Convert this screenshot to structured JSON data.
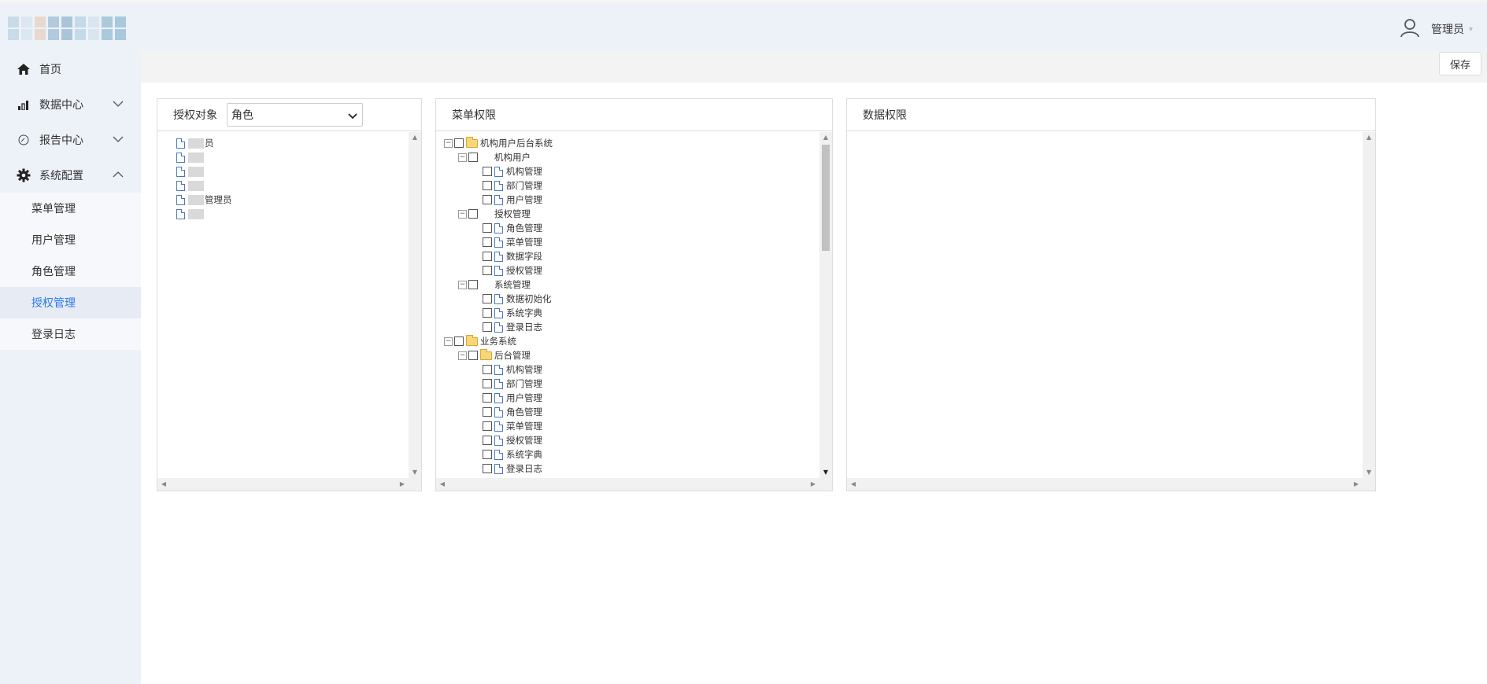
{
  "header": {
    "user_name": "管理员",
    "logo_tiles": [
      "#a8c8dc",
      "#e8d4c8",
      "#8cb4cc",
      "#c8dce8",
      "#9cc0d8",
      "#d4e4ee",
      "#7fa9c9",
      "#bcd6e6",
      "#90b8d0"
    ]
  },
  "sidebar": {
    "items": [
      {
        "label": "首页",
        "icon": "home-icon"
      },
      {
        "label": "数据中心",
        "icon": "bar-chart-icon"
      },
      {
        "label": "报告中心",
        "icon": "gauge-icon"
      },
      {
        "label": "系统配置",
        "icon": "gear-icon"
      }
    ],
    "sub_items": [
      {
        "label": "菜单管理"
      },
      {
        "label": "用户管理"
      },
      {
        "label": "角色管理"
      },
      {
        "label": "授权管理",
        "active": true
      },
      {
        "label": "登录日志"
      }
    ]
  },
  "toolbar": {
    "save_label": "保存"
  },
  "panels": {
    "auth_object": {
      "label": "授权对象",
      "select_value": "角色",
      "roles": [
        {
          "label": "员"
        },
        {
          "label": ""
        },
        {
          "label": ""
        },
        {
          "label": ""
        },
        {
          "label": "管理员"
        },
        {
          "label": ""
        }
      ]
    },
    "menu_perm": {
      "title": "菜单权限",
      "tree": [
        {
          "label": "机构用户后台系统",
          "level": 0,
          "toggle": "⊟",
          "folder": true
        },
        {
          "label": "机构用户",
          "level": 1,
          "toggle": "⊟",
          "folder": false
        },
        {
          "label": "机构管理",
          "level": 2,
          "doc": true
        },
        {
          "label": "部门管理",
          "level": 2,
          "doc": true
        },
        {
          "label": "用户管理",
          "level": 2,
          "doc": true
        },
        {
          "label": "授权管理",
          "level": 1,
          "toggle": "⊟",
          "folder": false
        },
        {
          "label": "角色管理",
          "level": 2,
          "doc": true
        },
        {
          "label": "菜单管理",
          "level": 2,
          "doc": true
        },
        {
          "label": "数据字段",
          "level": 2,
          "doc": true
        },
        {
          "label": "授权管理",
          "level": 2,
          "doc": true
        },
        {
          "label": "系统管理",
          "level": 1,
          "toggle": "⊟",
          "folder": false
        },
        {
          "label": "数据初始化",
          "level": 2,
          "doc": true
        },
        {
          "label": "系统字典",
          "level": 2,
          "doc": true
        },
        {
          "label": "登录日志",
          "level": 2,
          "doc": true
        },
        {
          "label": "业务系统",
          "level": 0,
          "toggle": "⊟",
          "folder": true
        },
        {
          "label": "后台管理",
          "level": 1,
          "toggle": "⊟",
          "folder": true
        },
        {
          "label": "机构管理",
          "level": 2,
          "doc": true
        },
        {
          "label": "部门管理",
          "level": 2,
          "doc": true
        },
        {
          "label": "用户管理",
          "level": 2,
          "doc": true
        },
        {
          "label": "角色管理",
          "level": 2,
          "doc": true
        },
        {
          "label": "菜单管理",
          "level": 2,
          "doc": true
        },
        {
          "label": "授权管理",
          "level": 2,
          "doc": true
        },
        {
          "label": "系统字典",
          "level": 2,
          "doc": true
        },
        {
          "label": "登录日志",
          "level": 2,
          "doc": true
        }
      ]
    },
    "data_perm": {
      "title": "数据权限"
    }
  }
}
